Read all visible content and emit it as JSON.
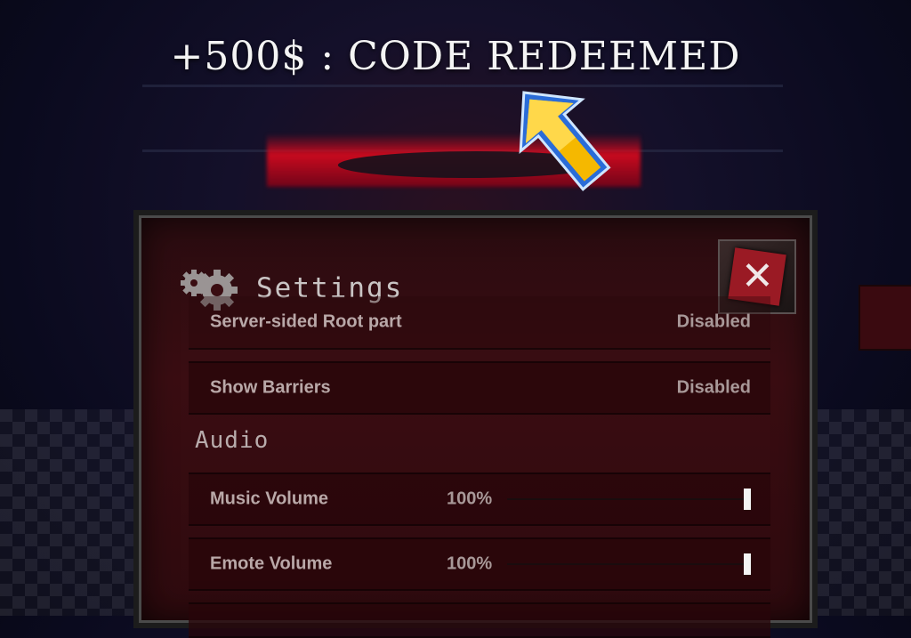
{
  "banner": {
    "text": "+500$ : CODE REDEEMED"
  },
  "icons": {
    "arrow": "pointer-arrow-icon",
    "gear": "gears-icon",
    "close": "close-icon"
  },
  "colors": {
    "panel_bg": "#3a0d12",
    "accent_red": "#9a1a24",
    "arrow_yellow": "#f5b800",
    "arrow_blue": "#2a6cd8"
  },
  "settings": {
    "title": "Settings",
    "rows": [
      {
        "label": "Server-sided Root part",
        "value": "Disabled"
      },
      {
        "label": "Show Barriers",
        "value": "Disabled"
      }
    ],
    "audio_section": "Audio",
    "volumes": [
      {
        "label": "Music Volume",
        "value": "100%",
        "level": 1.0
      },
      {
        "label": "Emote Volume",
        "value": "100%",
        "level": 1.0
      }
    ]
  }
}
